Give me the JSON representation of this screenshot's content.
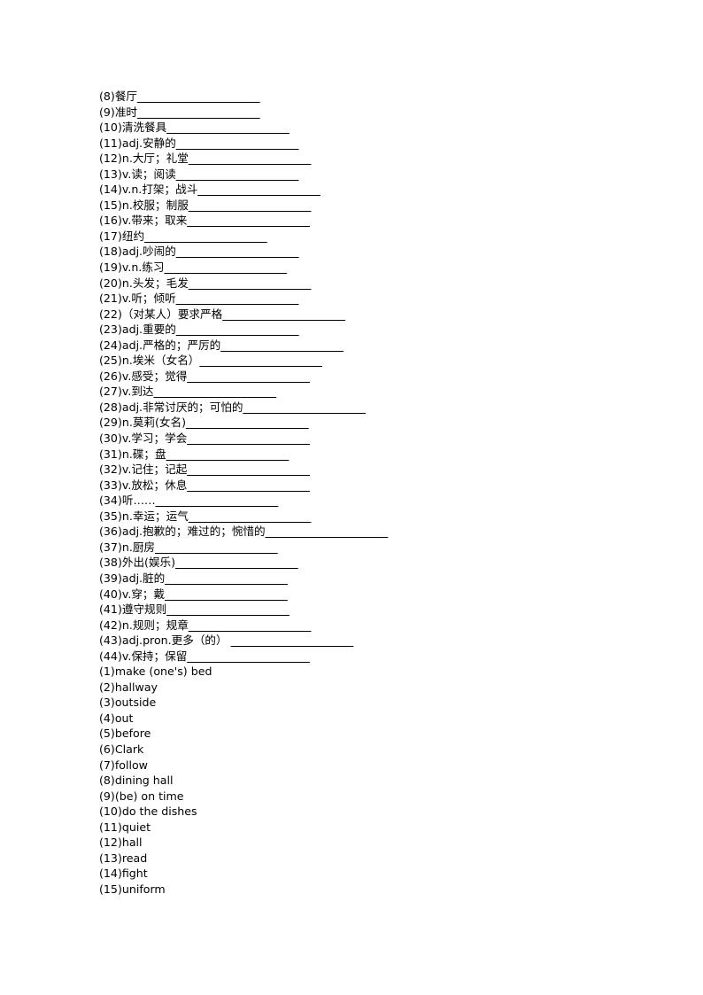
{
  "document": {
    "type": "vocabulary-worksheet",
    "background_color": "#ffffff",
    "text_color": "#000000"
  },
  "prompts": [
    {
      "label": "(8)餐厅",
      "blank": "______________________"
    },
    {
      "label": "(9)准时",
      "blank": "______________________"
    },
    {
      "label": "(10)清洗餐具",
      "blank": "______________________"
    },
    {
      "label": "(11)adj.安静的",
      "blank": "______________________"
    },
    {
      "label": "(12)n.大厅；礼堂",
      "blank": "______________________"
    },
    {
      "label": "(13)v.读；阅读",
      "blank": "______________________"
    },
    {
      "label": "(14)v.n.打架；战斗",
      "blank": "______________________"
    },
    {
      "label": "(15)n.校服；制服",
      "blank": "______________________"
    },
    {
      "label": "(16)v.带来；取来",
      "blank": "______________________"
    },
    {
      "label": "(17)纽约",
      "blank": "______________________"
    },
    {
      "label": "(18)adj.吵闹的",
      "blank": "______________________"
    },
    {
      "label": "(19)v.n.练习",
      "blank": "______________________"
    },
    {
      "label": "(20)n.头发；毛发",
      "blank": "______________________"
    },
    {
      "label": "(21)v.听；倾听",
      "blank": "______________________"
    },
    {
      "label": "(22)（对某人）要求严格",
      "blank": "______________________"
    },
    {
      "label": "(23)adj.重要的",
      "blank": "______________________"
    },
    {
      "label": "(24)adj.严格的；严厉的",
      "blank": "______________________"
    },
    {
      "label": "(25)n.埃米（女名）",
      "blank": "______________________"
    },
    {
      "label": "(26)v.感受；觉得",
      "blank": "______________________"
    },
    {
      "label": "(27)v.到达",
      "blank": "______________________"
    },
    {
      "label": "(28)adj.非常讨厌的；可怕的",
      "blank": "______________________"
    },
    {
      "label": "(29)n.莫莉(女名)",
      "blank": "______________________"
    },
    {
      "label": "(30)v.学习；学会",
      "blank": "______________________"
    },
    {
      "label": "(31)n.碟；盘",
      "blank": "______________________"
    },
    {
      "label": "(32)v.记住；记起",
      "blank": "______________________"
    },
    {
      "label": "(33)v.放松；休息",
      "blank": "______________________"
    },
    {
      "label": "(34)听……",
      "blank": "______________________"
    },
    {
      "label": "(35)n.幸运；运气",
      "blank": "______________________"
    },
    {
      "label": "(36)adj.抱歉的；难过的；惋惜的",
      "blank": "______________________"
    },
    {
      "label": "(37)n.厨房",
      "blank": "______________________"
    },
    {
      "label": "(38)外出(娱乐)",
      "blank": "______________________"
    },
    {
      "label": "(39)adj.脏的",
      "blank": "______________________"
    },
    {
      "label": "(40)v.穿；戴",
      "blank": "______________________"
    },
    {
      "label": "(41)遵守规则",
      "blank": "______________________"
    },
    {
      "label": "(42)n.规则；规章",
      "blank": "______________________"
    },
    {
      "label": "(43)adj.pron.更多（的） ",
      "blank": "______________________"
    },
    {
      "label": "(44)v.保持；保留",
      "blank": "______________________"
    }
  ],
  "answers": [
    "(1)make (one's) bed",
    "(2)hallway",
    "(3)outside",
    "(4)out",
    "(5)before",
    "(6)Clark",
    "(7)follow",
    "(8)dining hall",
    "(9)(be) on time",
    "(10)do the dishes",
    "(11)quiet",
    "(12)hall",
    "(13)read",
    "(14)fight",
    "(15)uniform"
  ]
}
